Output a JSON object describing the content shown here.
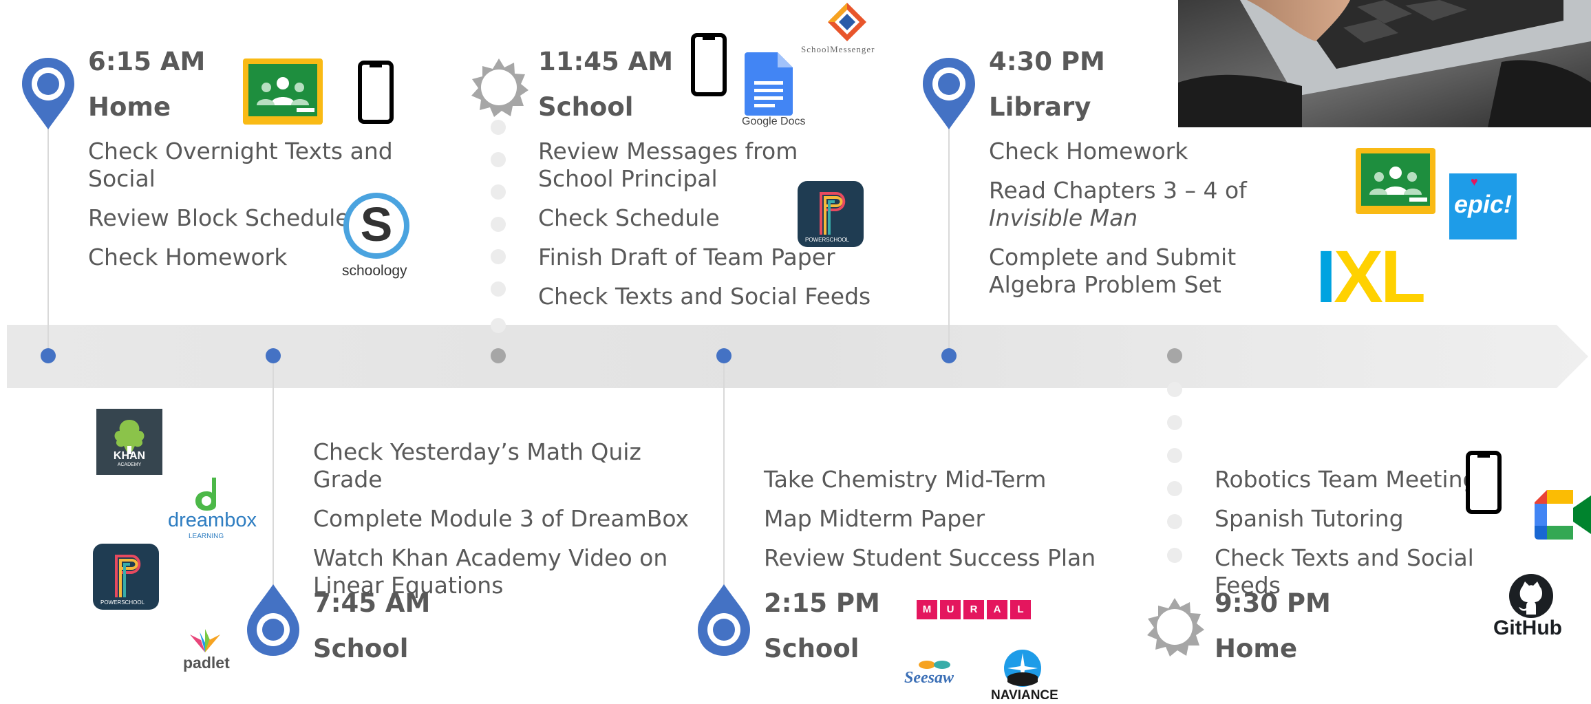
{
  "events": {
    "e1": {
      "time": "6:15 AM",
      "place": "Home",
      "tasks": [
        "Check Overnight Texts and Social",
        "Review Block Schedule",
        "Check Homework"
      ]
    },
    "e2": {
      "time": "7:45 AM",
      "place": "School",
      "tasks": [
        "Check Yesterday’s Math Quiz Grade",
        "Complete Module 3 of DreamBox",
        "Watch Khan Academy Video on Linear Equations"
      ]
    },
    "e3": {
      "time": "11:45 AM",
      "place": "School",
      "tasks": [
        "Review Messages from School Principal",
        "Check Schedule",
        "Finish Draft of Team Paper",
        "Check Texts and Social Feeds"
      ]
    },
    "e4": {
      "time": "2:15 PM",
      "place": "School",
      "tasks": [
        "Take Chemistry Mid-Term",
        "Map Midterm Paper",
        "Review Student Success Plan"
      ]
    },
    "e5": {
      "time": "4:30 PM",
      "place": "Library",
      "tasks": [
        "Check Homework",
        "Complete and Submit Algebra Problem Set"
      ],
      "read_task": {
        "prefix": "Read Chapters 3 – 4 of ",
        "book": "Invisible Man"
      }
    },
    "e6": {
      "time": "9:30 PM",
      "place": "Home",
      "tasks": [
        "Robotics Team Meeting",
        "Spanish Tutoring",
        "Check Texts and Social Feeds"
      ]
    }
  },
  "logos": {
    "schoology": "schoology",
    "schoology_mark": "S",
    "khan": "KHAN",
    "khan_sub": "ACADEMY",
    "dreambox": "dreambox",
    "dreambox_sub": "LEARNING",
    "powerschool": "POWERSCHOOL",
    "padlet": "padlet",
    "google_docs": "Google Docs",
    "schoolmessenger": "SchoolMessenger",
    "mural": [
      "M",
      "U",
      "R",
      "A",
      "L"
    ],
    "seesaw": "Seesaw",
    "naviance": "NAVIANCE",
    "epic": "epic!",
    "ixl": "IXL",
    "github": "GitHub"
  },
  "colors": {
    "blue": "#4472c4",
    "gray": "#a6a6a6",
    "text": "#595959",
    "arrow": "#e6e6e6",
    "classroom_green": "#1e8e3e",
    "classroom_yellow": "#f9ba15",
    "mural_pink": "#e4165e",
    "ixl_blue": "#00a3e0",
    "ixl_yellow": "#ffd100"
  },
  "icons": [
    "location-pin-icon",
    "starburst-icon",
    "phone-icon",
    "google-classroom-icon",
    "google-meet-icon",
    "github-icon"
  ]
}
